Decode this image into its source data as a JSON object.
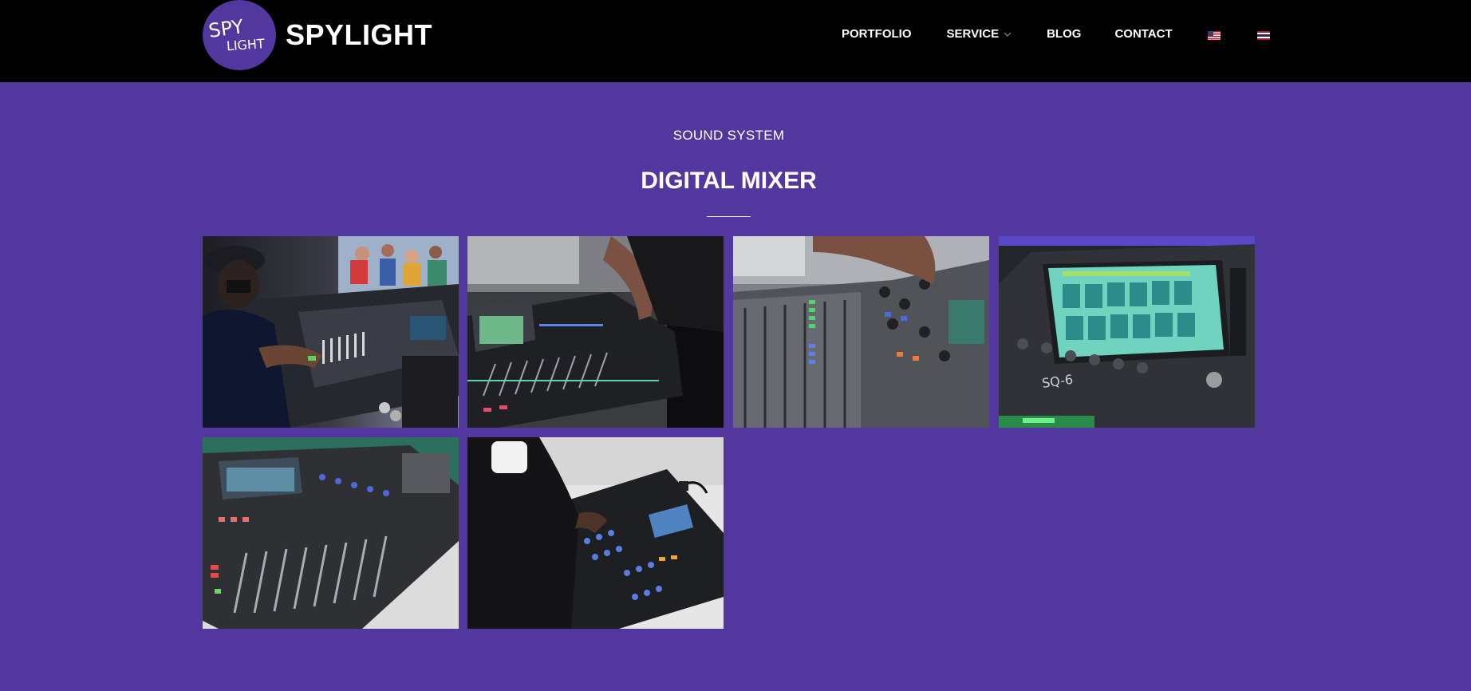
{
  "header": {
    "logo_text_line1": "SPY",
    "logo_text_line2": "LIGHT",
    "brand": "SPYLIGHT",
    "nav": [
      {
        "label": "PORTFOLIO"
      },
      {
        "label": "SERVICE",
        "has_dropdown": true
      },
      {
        "label": "BLOG"
      },
      {
        "label": "CONTACT"
      }
    ],
    "languages": [
      "english-flag",
      "thai-flag"
    ]
  },
  "main": {
    "section_label": "SOUND SYSTEM",
    "section_title": "DIGITAL MIXER",
    "gallery": [
      {
        "name": "gallery-photo-operator-at-mixer"
      },
      {
        "name": "gallery-photo-mixer-faders-closeup"
      },
      {
        "name": "gallery-photo-hand-on-mixer-knobs"
      },
      {
        "name": "gallery-photo-sq6-screen",
        "printed_text": "SQ-6"
      },
      {
        "name": "gallery-photo-mixer-side-view"
      },
      {
        "name": "gallery-photo-technician-operating-mixer"
      }
    ]
  },
  "colors": {
    "background": "#52389e",
    "header": "#000000",
    "text": "#ffffff"
  }
}
